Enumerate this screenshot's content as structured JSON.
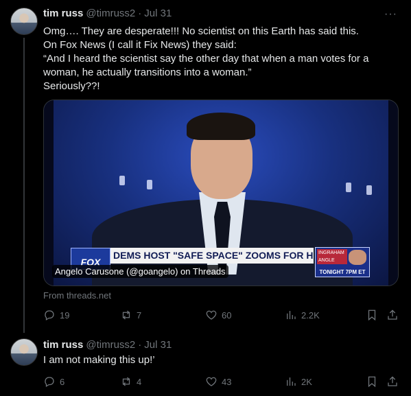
{
  "tweets": [
    {
      "name": "tim russ",
      "handle": "@timruss2",
      "separator": "·",
      "time": "Jul 31",
      "more": "···",
      "lines": [
        "Omg…. They are desperate!!! No scientist on this Earth has said this.",
        "On Fox News (I call it Fix News) they said:",
        "“And I heard the scientist say the other day that when a man votes for a",
        "woman, he actually transitions into a woman.”",
        "Seriously??!"
      ],
      "media": {
        "network_logo": "FOX",
        "headline": "DEMS HOST \"SAFE SPACE\" ZOOMS FOR HARRIS SUPPORTERS",
        "promo_top": "INGRAHAM ANGLE",
        "promo_bottom": "TONIGHT 7PM ET",
        "caption": "Angelo Carusone (@goangelo) on Threads"
      },
      "source": "From threads.net",
      "stats": {
        "replies": "19",
        "reposts": "7",
        "likes": "60",
        "views": "2.2K"
      }
    },
    {
      "name": "tim russ",
      "handle": "@timruss2",
      "separator": "·",
      "time": "Jul 31",
      "lines": [
        "I am not making this up!’"
      ],
      "stats": {
        "replies": "6",
        "reposts": "4",
        "likes": "43",
        "views": "2K"
      }
    }
  ],
  "icons": [
    "reply-icon",
    "repost-icon",
    "like-icon",
    "views-icon",
    "bookmark-icon",
    "share-icon",
    "more-icon"
  ],
  "colors": {
    "background": "#000000",
    "text": "#e7e9ea",
    "muted": "#71767b",
    "divider": "#2f3336"
  }
}
